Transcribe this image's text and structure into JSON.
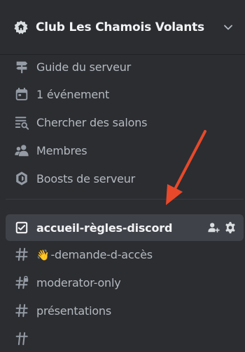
{
  "server": {
    "name": "Club Les Chamois Volants"
  },
  "nav": {
    "guide": "Guide du serveur",
    "events": "1 événement",
    "browse": "Chercher des salons",
    "members": "Membres",
    "boosts": "Boosts de serveur"
  },
  "channels": [
    {
      "label": "accueil-règles-discord",
      "icon": "rules-channel-icon",
      "selected": true
    },
    {
      "emoji": "👋",
      "label": "-demande-d-accès",
      "icon": "hashtag-icon"
    },
    {
      "label": "moderator-only",
      "icon": "locked-hashtag-icon"
    },
    {
      "label": "présentations",
      "icon": "hashtag-icon"
    }
  ],
  "colors": {
    "background": "#2b2d31",
    "selected": "#404249",
    "arrow": "#e8492a",
    "text_muted": "#b5bac1",
    "text_bright": "#f2f3f5"
  }
}
